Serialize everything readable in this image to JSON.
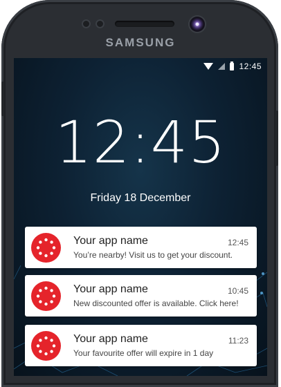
{
  "device": {
    "brand": "SAMSUNG"
  },
  "statusbar": {
    "time": "12:45"
  },
  "lockscreen": {
    "clock": "12:45",
    "date": "Friday 18 December"
  },
  "notifications": [
    {
      "app": "Your app name",
      "time": "12:45",
      "message": "You’re nearby! Visit us to get your discount."
    },
    {
      "app": "Your app name",
      "time": "10:45",
      "message": "New discounted offer is available. Click here!"
    },
    {
      "app": "Your app name",
      "time": "11:23",
      "message": "Your favourite offer will expire in 1 day"
    }
  ],
  "colors": {
    "accent": "#e5242b",
    "phone": "#2b2e33"
  },
  "icons": [
    "wifi-icon",
    "signal-icon",
    "battery-icon",
    "app-logo-icon"
  ]
}
